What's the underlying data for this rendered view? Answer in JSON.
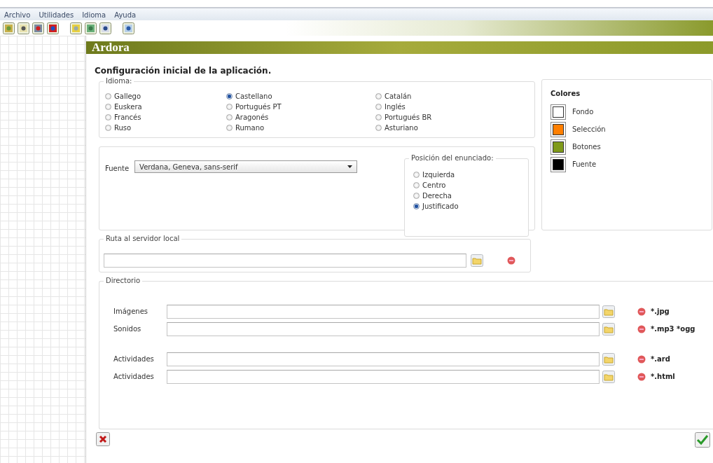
{
  "menu": [
    {
      "label": "Archivo"
    },
    {
      "label": "Utilidades"
    },
    {
      "label": "Idioma"
    },
    {
      "label": "Ayuda"
    }
  ],
  "app_title": "Ardora",
  "heading": "Configuración inicial de la aplicación.",
  "idioma": {
    "label": "Idioma:",
    "columns": [
      [
        {
          "label": "Gallego",
          "selected": false
        },
        {
          "label": "Euskera",
          "selected": false
        },
        {
          "label": "Francés",
          "selected": false
        },
        {
          "label": "Ruso",
          "selected": false
        }
      ],
      [
        {
          "label": "Castellano",
          "selected": true
        },
        {
          "label": "Portugués PT",
          "selected": false
        },
        {
          "label": "Aragonés",
          "selected": false
        },
        {
          "label": "Rumano",
          "selected": false
        }
      ],
      [
        {
          "label": "Catalán",
          "selected": false
        },
        {
          "label": "Inglés",
          "selected": false
        },
        {
          "label": "Portugués BR",
          "selected": false
        },
        {
          "label": "Asturiano",
          "selected": false
        }
      ]
    ]
  },
  "fuente": {
    "label": "Fuente",
    "value": "Verdana, Geneva, sans-serif"
  },
  "posicion": {
    "label": "Posición del enunciado:",
    "options": [
      {
        "label": "Izquierda",
        "selected": false
      },
      {
        "label": "Centro",
        "selected": false
      },
      {
        "label": "Derecha",
        "selected": false
      },
      {
        "label": "Justificado",
        "selected": true
      }
    ]
  },
  "colores": {
    "title": "Colores",
    "items": [
      {
        "label": "Fondo",
        "color": "#ffffff"
      },
      {
        "label": "Selección",
        "color": "#ff7f00"
      },
      {
        "label": "Botones",
        "color": "#7f9a1a"
      },
      {
        "label": "Fuente",
        "color": "#000000"
      }
    ]
  },
  "ruta": {
    "label": "Ruta al servidor local"
  },
  "directorio": {
    "label": "Directorio",
    "rows": [
      {
        "label": "Imágenes",
        "extension": "*.jpg"
      },
      {
        "label": "Sonidos",
        "extension": "*.mp3 *ogg"
      },
      {
        "label": "Actividades",
        "extension": "*.ard"
      },
      {
        "label": "Actividades",
        "extension": "*.html"
      }
    ]
  }
}
